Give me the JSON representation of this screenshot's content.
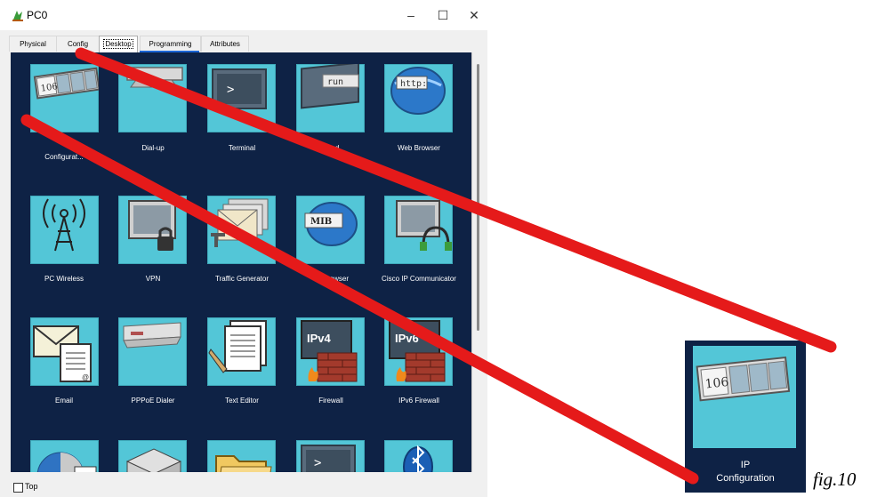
{
  "window": {
    "title": "PC0",
    "minimize": "–",
    "maximize": "☐",
    "close": "✕"
  },
  "tabs": [
    "Physical",
    "Config",
    "Desktop",
    "Programming",
    "Attributes"
  ],
  "active_tab": "Desktop",
  "apps": [
    {
      "label": "IP Configuration",
      "icon": "ip-configuration-icon",
      "visible_label": "Configurat..."
    },
    {
      "label": "Dial-up",
      "icon": "dial-up-icon"
    },
    {
      "label": "Terminal",
      "icon": "terminal-icon"
    },
    {
      "label": "Command Prompt",
      "icon": "command-prompt-icon",
      "visible_label": "...mand"
    },
    {
      "label": "Web Browser",
      "icon": "web-browser-icon"
    },
    {
      "label": "PC Wireless",
      "icon": "wireless-icon"
    },
    {
      "label": "VPN",
      "icon": "vpn-icon"
    },
    {
      "label": "Traffic Generator",
      "icon": "traffic-generator-icon"
    },
    {
      "label": "MIB Browser",
      "icon": "mib-browser-icon",
      "visible_label": "...owser"
    },
    {
      "label": "Cisco IP Communicator",
      "icon": "ip-communicator-icon"
    },
    {
      "label": "Email",
      "icon": "email-icon"
    },
    {
      "label": "PPPoE Dialer",
      "icon": "pppoe-dialer-icon"
    },
    {
      "label": "Text Editor",
      "icon": "text-editor-icon"
    },
    {
      "label": "Firewall",
      "icon": "firewall-icon"
    },
    {
      "label": "IPv6 Firewall",
      "icon": "ipv6-firewall-icon"
    }
  ],
  "icon_text": {
    "ipconfig_counter": "106",
    "terminal_prompt": ">",
    "run": "run",
    "http": "http:",
    "mib": "MIB",
    "ipv4": "IPv4",
    "ipv6": "IPv6"
  },
  "bottom": {
    "checkbox_label": "Top"
  },
  "zoom": {
    "line1": "IP",
    "line2": "Configuration"
  },
  "caption": "fig.10",
  "colors": {
    "desktop_bg": "#0e2245",
    "tile": "#53c6d7",
    "annotation": "#e51a1a",
    "tab_underline": "#1c66d6"
  }
}
